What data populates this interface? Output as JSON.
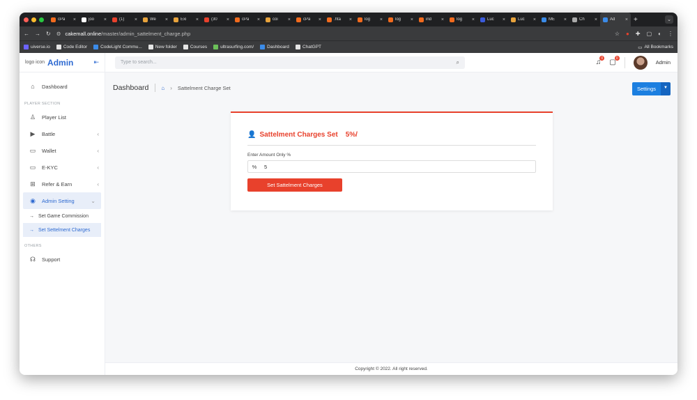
{
  "browser": {
    "tabs": [
      {
        "title": "cPa",
        "color": "#f26b1d"
      },
      {
        "title": "joo",
        "color": "#ffffff"
      },
      {
        "title": "(1)",
        "color": "#e8412c"
      },
      {
        "title": "We",
        "color": "#e8a33c"
      },
      {
        "title": "Exi",
        "color": "#e8a33c"
      },
      {
        "title": "(30",
        "color": "#e8412c"
      },
      {
        "title": "cPa",
        "color": "#f26b1d"
      },
      {
        "title": "coi",
        "color": "#e8a33c"
      },
      {
        "title": "cPa",
        "color": "#f26b1d"
      },
      {
        "title": ".hta",
        "color": "#f26b1d"
      },
      {
        "title": "log",
        "color": "#f26b1d"
      },
      {
        "title": "log",
        "color": "#f26b1d"
      },
      {
        "title": "ind",
        "color": "#f26b1d"
      },
      {
        "title": "log",
        "color": "#f26b1d"
      },
      {
        "title": "Luc",
        "color": "#3b5bdb"
      },
      {
        "title": "Luc",
        "color": "#e8a33c"
      },
      {
        "title": "ME",
        "color": "#3b8be8"
      },
      {
        "title": "Ch",
        "color": "#aaaaaa"
      },
      {
        "title": "Ad",
        "color": "#3b8be8"
      }
    ],
    "url_host": "cakemall.online",
    "url_path": "/master/admin_sattelment_charge.php",
    "bookmarks": [
      {
        "label": "uiverse.io",
        "color": "#6c63ff"
      },
      {
        "label": "Code Editor",
        "color": "#e5e5e5"
      },
      {
        "label": "CodeLight Commu...",
        "color": "#3b8be8"
      },
      {
        "label": "New folder",
        "color": "#e5e5e5"
      },
      {
        "label": "Courses",
        "color": "#e5e5e5"
      },
      {
        "label": "ultrasurfing.com/",
        "color": "#6bbf59"
      },
      {
        "label": "Dashboard",
        "color": "#3b8be8"
      },
      {
        "label": "ChatGPT",
        "color": "#e5e5e5"
      }
    ],
    "all_bookmarks": "All Bookmarks"
  },
  "sidebar": {
    "logo_alt": "logo icon",
    "brand": "Admin",
    "dashboard": "Dashboard",
    "section_player": "PLAYER SECTION",
    "player_list": "Player List",
    "battle": "Battle",
    "wallet": "Wallet",
    "ekyc": "E-KYC",
    "refer": "Refer & Earn",
    "admin_setting": "Admin Setting",
    "sub_commission": "Set Game Commission",
    "sub_settlement": "Set Settelment Charges",
    "section_others": "OTHERS",
    "support": "Support"
  },
  "topbar": {
    "search_placeholder": "Type to search...",
    "notif_count": "0",
    "msg_count": "0",
    "user_name": "Admin"
  },
  "breadcrumb": {
    "title": "Dashboard",
    "current": "Sattelment Charge Set"
  },
  "settings_button": "Settings",
  "card": {
    "title": "Sattelment Charges Set",
    "rate": "5%/",
    "label": "Enter Amount Only %",
    "prefix": "%",
    "value": "5",
    "submit": "Set Sattelment Charges"
  },
  "footer": "Copyright © 2022. All right reserved."
}
